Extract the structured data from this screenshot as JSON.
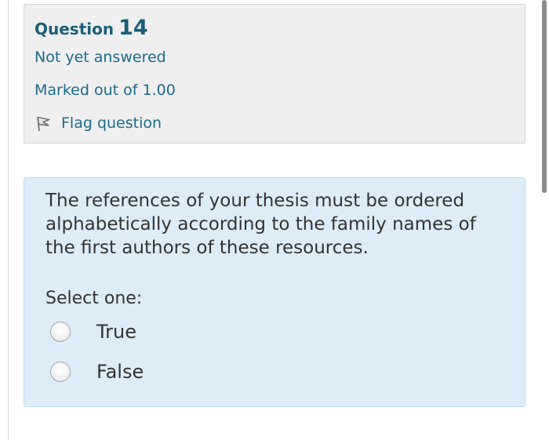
{
  "question_info": {
    "label": "Question",
    "number": "14",
    "state": "Not yet answered",
    "grade": "Marked out of 1.00",
    "flag_label": "Flag question",
    "flag_icon": "flag-icon"
  },
  "question": {
    "text": "The references of your thesis must be ordered alphabetically according to the family names of the first authors of these resources.",
    "prompt": "Select one:",
    "options": [
      {
        "label": "True",
        "selected": false
      },
      {
        "label": "False",
        "selected": false
      }
    ]
  },
  "colors": {
    "info_background": "#efefef",
    "content_background": "#dcedf8",
    "content_border": "#b8dcef",
    "link_text": "#1a6b8a"
  }
}
